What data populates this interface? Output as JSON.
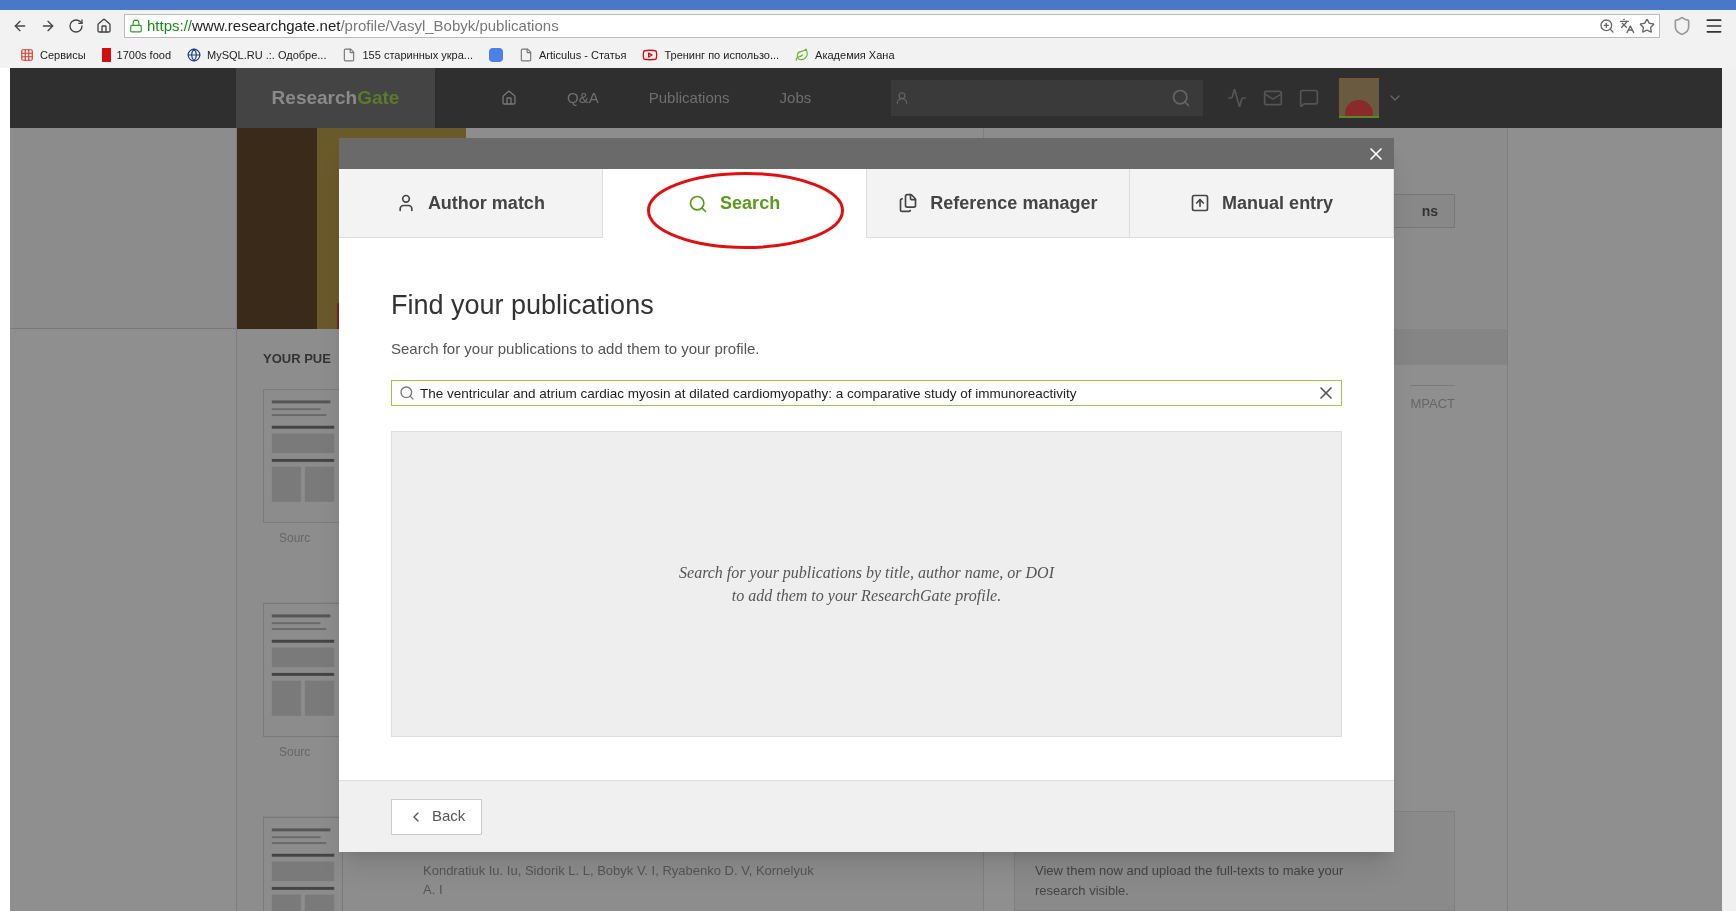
{
  "browser": {
    "address": {
      "scheme": "https://",
      "host": "www.researchgate.net",
      "path": "/profile/Vasyl_Bobyk/publications"
    },
    "bookmarks": [
      {
        "label": "Сервисы",
        "kind": "apps"
      },
      {
        "label": "1700s food",
        "kind": "red"
      },
      {
        "label": "MySQL.RU .:. Одобре...",
        "kind": "globe"
      },
      {
        "label": "155 старинных укра...",
        "kind": "page"
      },
      {
        "kind": "google"
      },
      {
        "label": "Articulus - Статья",
        "kind": "page"
      },
      {
        "label": "Тренинг по использо...",
        "kind": "video"
      },
      {
        "label": "Академия Хана",
        "kind": "leaf"
      }
    ]
  },
  "nav": {
    "logo": {
      "first": "Research",
      "second": "Gate"
    },
    "items": [
      "Q&A",
      "Publications",
      "Jobs"
    ]
  },
  "background": {
    "section_heading": "YOUR PUE",
    "source_labels": [
      "Sourc",
      "Sourc"
    ],
    "button_fragment": "ns",
    "column_fragment": "MPACT",
    "authors": [
      "Kondratiuk Iu. Iu, Sidorik L. L, Bobyk V. I, Ryabenko D. V, Kornelyuk",
      "A. I"
    ],
    "info": [
      "View them now and upload the full-texts to make your",
      "research visible."
    ]
  },
  "modal": {
    "tabs": [
      {
        "label": "Author match",
        "kind": "person",
        "selected": false,
        "circled": false
      },
      {
        "label": "Search",
        "kind": "search",
        "selected": true,
        "circled": true
      },
      {
        "label": "Reference manager",
        "kind": "files",
        "selected": false,
        "circled": false
      },
      {
        "label": "Manual entry",
        "kind": "upload",
        "selected": false,
        "circled": false
      }
    ],
    "title": "Find your publications",
    "subtitle": "Search for your publications to add them to your profile.",
    "search": {
      "value": "The ventricular and atrium cardiac myosin at dilated cardiomyopathy: a comparative study of immunoreactivity"
    },
    "empty_state": [
      "Search for your publications by title, author name, or DOI",
      "to add them to your ResearchGate profile."
    ],
    "back_button": "Back"
  }
}
